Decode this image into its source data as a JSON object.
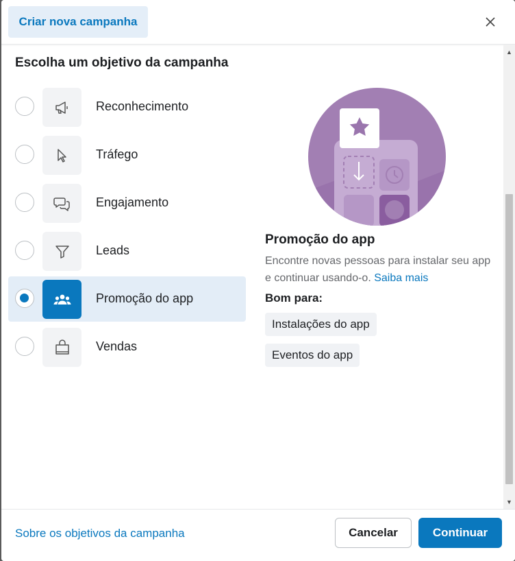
{
  "header": {
    "tab_label": "Criar nova campanha",
    "close_icon": "close-icon"
  },
  "section_title": "Escolha um objetivo da campanha",
  "objectives": [
    {
      "label": "Reconhecimento",
      "icon": "megaphone-icon",
      "selected": false
    },
    {
      "label": "Tráfego",
      "icon": "cursor-icon",
      "selected": false
    },
    {
      "label": "Engajamento",
      "icon": "chat-bubbles-icon",
      "selected": false
    },
    {
      "label": "Leads",
      "icon": "filter-icon",
      "selected": false
    },
    {
      "label": "Promoção do app",
      "icon": "people-icon",
      "selected": true
    },
    {
      "label": "Vendas",
      "icon": "shopping-bag-icon",
      "selected": false
    }
  ],
  "detail": {
    "title": "Promoção do app",
    "description": "Encontre novas pessoas para instalar seu app e continuar usando-o.",
    "learn_more": "Saiba mais",
    "good_for_label": "Bom para:",
    "chips": [
      "Instalações do app",
      "Eventos do app"
    ]
  },
  "footer": {
    "link": "Sobre os objetivos da campanha",
    "cancel": "Cancelar",
    "continue": "Continuar"
  },
  "colors": {
    "accent": "#0a78be",
    "selected_bg": "#e3edf7",
    "illustration": "#a583b5"
  }
}
